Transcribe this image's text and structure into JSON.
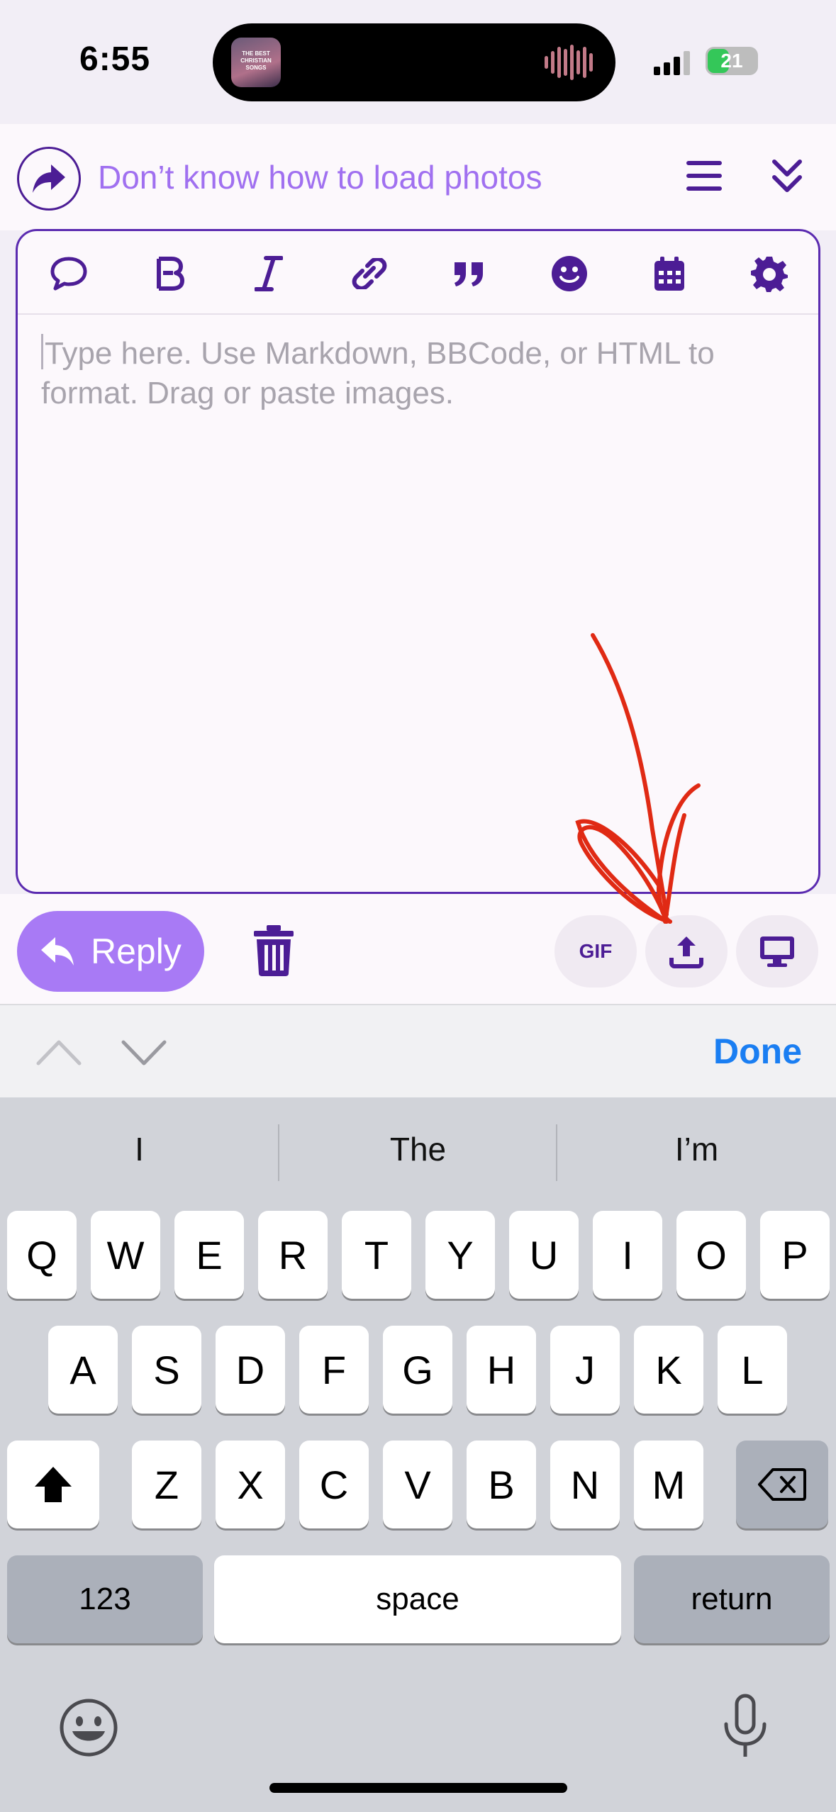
{
  "status_bar": {
    "time": "6:55",
    "album_art_text": "THE BEST CHRISTIAN SONGS",
    "battery": "21"
  },
  "composer": {
    "topic_title": "Don’t know how to load photos",
    "editor_placeholder": "Type here. Use Markdown, BBCode, or HTML to format. Drag or paste images.",
    "toolbar_icons": [
      "quote-bubble-icon",
      "bold-icon",
      "italic-icon",
      "link-icon",
      "blockquote-icon",
      "emoji-icon",
      "calendar-icon",
      "gear-icon"
    ],
    "reply_label": "Reply",
    "gif_label": "GIF",
    "accent_color": "#a87af5",
    "icon_color": "#4c1d95",
    "annotation_color": "#e02a14"
  },
  "keyboard_accessory": {
    "done_label": "Done"
  },
  "keyboard": {
    "suggestions": [
      "I",
      "The",
      "I’m"
    ],
    "row1": [
      "Q",
      "W",
      "E",
      "R",
      "T",
      "Y",
      "U",
      "I",
      "O",
      "P"
    ],
    "row2": [
      "A",
      "S",
      "D",
      "F",
      "G",
      "H",
      "J",
      "K",
      "L"
    ],
    "row3": [
      "Z",
      "X",
      "C",
      "V",
      "B",
      "N",
      "M"
    ],
    "numbers_label": "123",
    "space_label": "space",
    "return_label": "return"
  }
}
